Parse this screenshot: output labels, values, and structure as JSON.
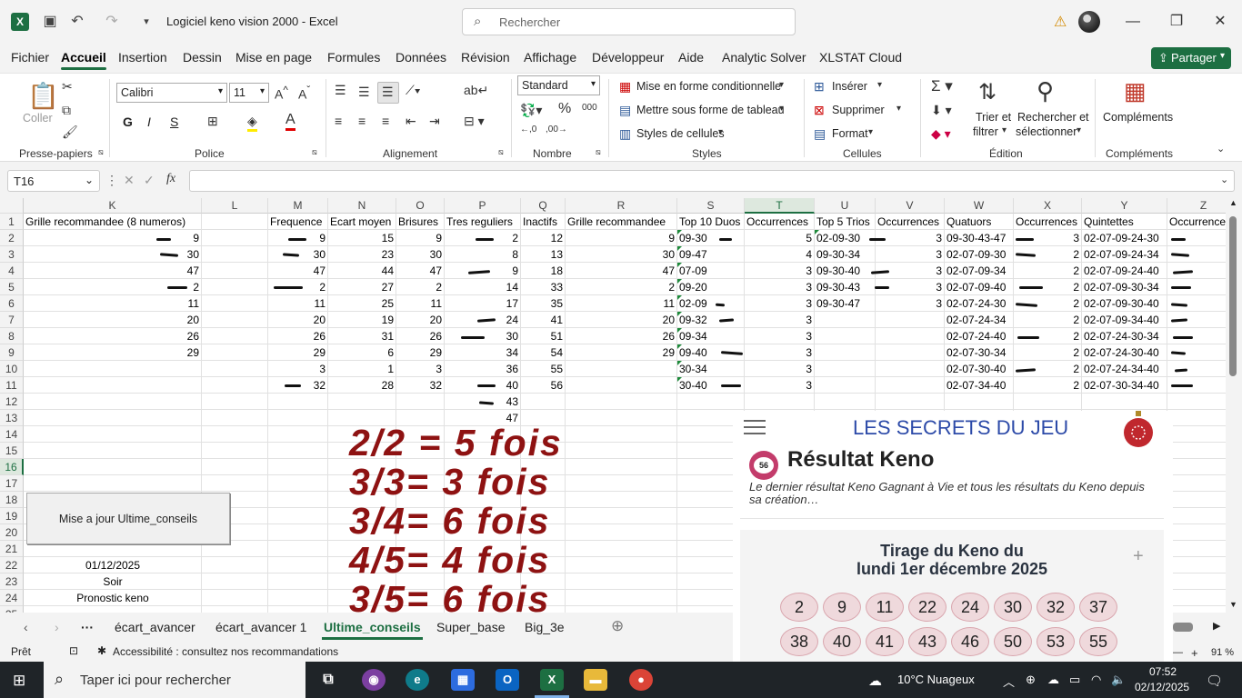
{
  "titlebar": {
    "doc_title": "Logiciel keno vision 2000  -  Excel",
    "search_placeholder": "Rechercher"
  },
  "menu": [
    "Fichier",
    "Accueil",
    "Insertion",
    "Dessin",
    "Mise en page",
    "Formules",
    "Données",
    "Révision",
    "Affichage",
    "Développeur",
    "Aide",
    "Analytic Solver",
    "XLSTAT Cloud"
  ],
  "share_label": "Partager",
  "ribbon": {
    "coller": "Coller",
    "presse_papiers": "Presse-papiers",
    "font_name": "Calibri",
    "font_size": "11",
    "bold": "G",
    "italic": "I",
    "underline": "S",
    "police": "Police",
    "alignement": "Alignement",
    "number_format": "Standard",
    "nombre": "Nombre",
    "mise_en_forme_cond": "Mise en forme conditionnelle",
    "mettre_sous_forme": "Mettre sous forme de tableau",
    "styles_cellules": "Styles de cellules",
    "styles": "Styles",
    "inserer": "Insérer",
    "supprimer": "Supprimer",
    "format": "Format",
    "cellules": "Cellules",
    "trier_1": "Trier et",
    "trier_2": "filtrer",
    "rech_1": "Rechercher et",
    "rech_2": "sélectionner",
    "edition": "Édition",
    "complements": "Compléments",
    "complements_group": "Compléments"
  },
  "formula_bar": {
    "name_box": "T16",
    "formula": ""
  },
  "columns": [
    "K",
    "L",
    "M",
    "N",
    "O",
    "P",
    "Q",
    "R",
    "S",
    "T",
    "U",
    "V",
    "W",
    "X",
    "Y",
    "Z"
  ],
  "selected_column": "T",
  "rows": [
    "1",
    "2",
    "3",
    "4",
    "5",
    "6",
    "7",
    "8",
    "9",
    "10",
    "11",
    "12",
    "13",
    "14",
    "15",
    "16",
    "17",
    "18",
    "19",
    "20",
    "21",
    "22",
    "23",
    "24",
    "25"
  ],
  "selected_row": "16",
  "headers": {
    "K": "Grille recommandee (8 numeros)",
    "M": "Frequence",
    "N": "Ecart moyen",
    "O": "Brisures",
    "P": "Tres reguliers",
    "Q": "Inactifs",
    "R": "Grille recommandee",
    "S": "Top 10 Duos",
    "T": "Occurrences",
    "U": "Top 5 Trios",
    "V": "Occurrences",
    "W": "Quatuors",
    "X": "Occurrences",
    "Y": "Quintettes",
    "Z": "Occurrences"
  },
  "table": {
    "K": [
      "9",
      "30",
      "47",
      "2",
      "11",
      "20",
      "26",
      "29"
    ],
    "M": [
      "9",
      "30",
      "47",
      "2",
      "11",
      "20",
      "26",
      "29",
      "3",
      "32"
    ],
    "N": [
      "15",
      "23",
      "44",
      "27",
      "25",
      "19",
      "31",
      "6",
      "1",
      "28"
    ],
    "O": [
      "9",
      "30",
      "47",
      "2",
      "11",
      "20",
      "26",
      "29",
      "3",
      "32"
    ],
    "P": [
      "2",
      "8",
      "9",
      "14",
      "17",
      "24",
      "30",
      "34",
      "36",
      "40",
      "43",
      "47"
    ],
    "Q": [
      "12",
      "13",
      "18",
      "33",
      "35",
      "41",
      "51",
      "54",
      "55",
      "56"
    ],
    "R": [
      "9",
      "30",
      "47",
      "2",
      "11",
      "20",
      "26",
      "29"
    ],
    "S": [
      "09-30",
      "09-47",
      "07-09",
      "09-20",
      "02-09",
      "09-32",
      "09-34",
      "09-40",
      "30-34",
      "30-40"
    ],
    "T": [
      "5",
      "4",
      "3",
      "3",
      "3",
      "3",
      "3",
      "3",
      "3",
      "3"
    ],
    "U": [
      "02-09-30",
      "09-30-34",
      "09-30-40",
      "09-30-43",
      "09-30-47"
    ],
    "V": [
      "3",
      "3",
      "3",
      "3",
      "3"
    ],
    "W": [
      "09-30-43-47",
      "02-07-09-30",
      "02-07-09-34",
      "02-07-09-40",
      "02-07-24-30",
      "02-07-24-34",
      "02-07-24-40",
      "02-07-30-34",
      "02-07-30-40",
      "02-07-34-40"
    ],
    "X": [
      "3",
      "2",
      "2",
      "2",
      "2",
      "2",
      "2",
      "2",
      "2",
      "2"
    ],
    "Y": [
      "02-07-09-24-30",
      "02-07-09-24-34",
      "02-07-09-24-40",
      "02-07-09-30-34",
      "02-07-09-30-40",
      "02-07-09-34-40",
      "02-07-24-30-34",
      "02-07-24-30-40",
      "02-07-24-34-40",
      "02-07-30-34-40"
    ]
  },
  "side_cells": {
    "date": "01/12/2025",
    "soir": "Soir",
    "pronostic": "Pronostic keno"
  },
  "macro_button": "Mise a jour Ultime_conseils",
  "big_text": [
    "2/2 = 5 fois",
    "3/3= 3 fois",
    "3/4= 6 fois",
    "4/5= 4 fois",
    "3/5= 6 fois"
  ],
  "keno": {
    "logo": "LES SECRETS DU JEU",
    "badge": "56",
    "title": "Résultat Keno",
    "desc": "Le dernier résultat Keno Gagnant à Vie et tous les résultats du Keno depuis sa création…",
    "draw_line1": "Tirage du Keno du",
    "draw_line2": "lundi 1er décembre 2025",
    "balls": [
      "2",
      "9",
      "11",
      "22",
      "24",
      "30",
      "32",
      "37",
      "38",
      "40",
      "41",
      "43",
      "46",
      "50",
      "53",
      "55"
    ]
  },
  "sheet_tabs": [
    "écart_avancer",
    "écart_avancer 1",
    "Ultime_conseils",
    "Super_base",
    "Big_3e"
  ],
  "active_sheet": "Ultime_conseils",
  "status": {
    "ready": "Prêt",
    "accessibility": "Accessibilité : consultez nos recommandations",
    "zoom": "91 %"
  },
  "taskbar": {
    "search": "Taper ici pour rechercher",
    "weather": "10°C  Nuageux",
    "time": "07:52",
    "date": "02/12/2025"
  },
  "colors": {
    "excel_green": "#1d6f42",
    "big_text": "#8e1212",
    "keno_blue": "#2c4aa8",
    "ball": "#efd9dc"
  }
}
